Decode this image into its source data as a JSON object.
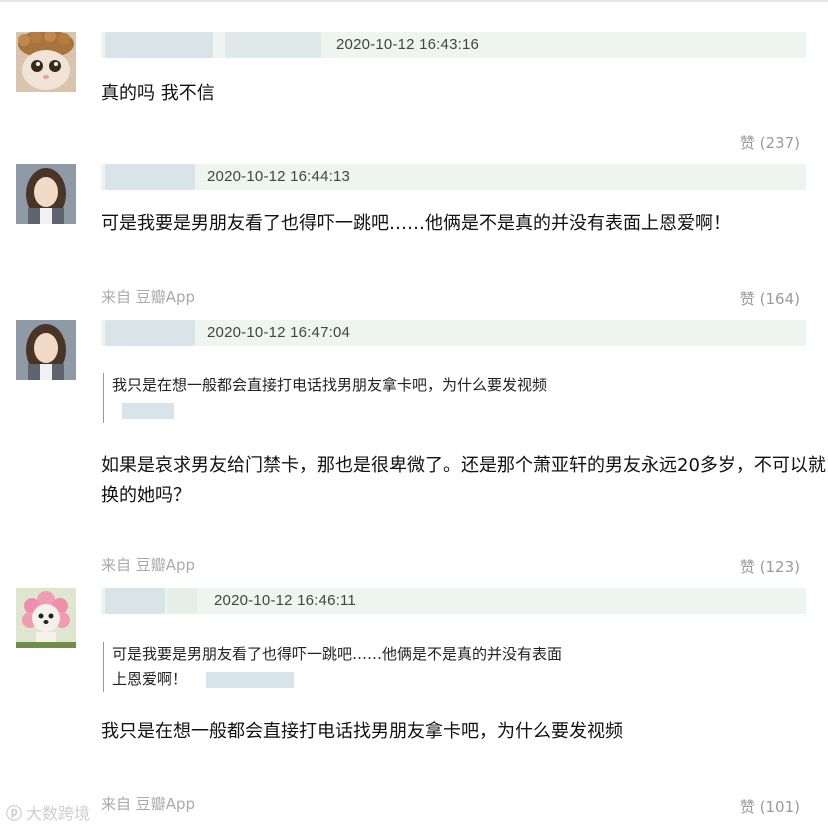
{
  "comments": [
    {
      "timestamp": "2020-10-12 16:43:16",
      "body": "真的吗 我不信",
      "likes_label": "赞 (237)",
      "avatar_icon": "cat-with-hat-avatar"
    },
    {
      "timestamp": "2020-10-12 16:44:13",
      "body": "可是我要是男朋友看了也得吓一跳吧……他俩是不是真的并没有表面上恩爱啊！",
      "source": "来自 豆瓣App",
      "likes_label": "赞 (164)",
      "avatar_icon": "woman-portrait-avatar"
    },
    {
      "timestamp": "2020-10-12 16:47:04",
      "quote": "我只是在想一般都会直接打电话找男朋友拿卡吧，为什么要发视频",
      "body_line1": "如果是哀求男友给门禁卡，那也是很卑微了。还是那个萧亚轩的男友永远20多岁，不可以就",
      "body_line2": "换的她吗？",
      "source": "来自 豆瓣App",
      "likes_label": "赞 (123)",
      "avatar_icon": "woman-portrait-avatar"
    },
    {
      "timestamp": "2020-10-12 16:46:11",
      "quote_line1": "可是我要是男朋友看了也得吓一跳吧……他俩是不是真的并没有表面",
      "quote_line2": "上恩爱啊！",
      "body": "我只是在想一般都会直接打电话找男朋友拿卡吧，为什么要发视频",
      "source": "来自 豆瓣App",
      "likes_label": "赞 (101)",
      "avatar_icon": "flower-costume-dog-avatar"
    }
  ],
  "watermark": "大数跨境",
  "colors": {
    "header_bg": "#eef4f0",
    "muted": "#9b9b9b",
    "text": "#111111"
  }
}
